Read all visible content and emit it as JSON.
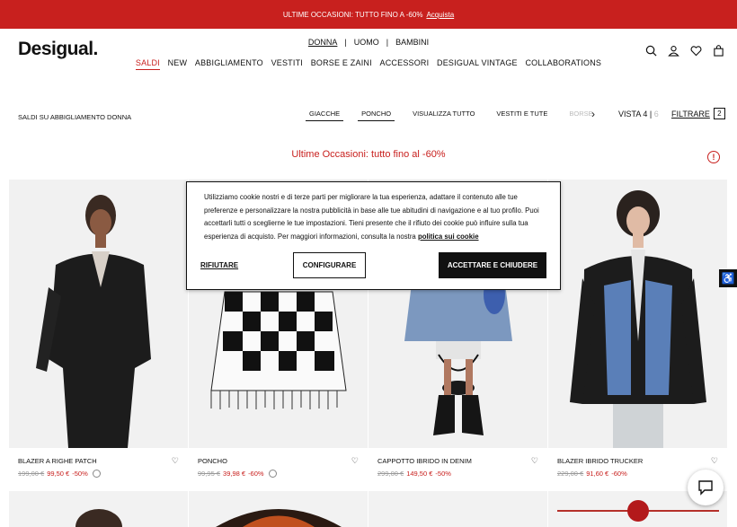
{
  "promo": {
    "text": "ULTIME OCCASIONI: TUTTO FINO A -60%",
    "link": "Acquista"
  },
  "header": {
    "logo": "Desigual.",
    "gender_nav": [
      "DONNA",
      "UOMO",
      "BAMBINI"
    ],
    "separator": "|",
    "main_nav": [
      "SALDI",
      "NEW",
      "ABBIGLIAMENTO",
      "VESTITI",
      "BORSE E ZAINI",
      "ACCESSORI",
      "DESIGUAL VINTAGE",
      "COLLABORATIONS"
    ],
    "icons": [
      "search-icon",
      "user-icon",
      "heart-icon",
      "bag-icon"
    ]
  },
  "subbar": {
    "breadcrumb": "SALDI SU ABBIGLIAMENTO DONNA",
    "chips": [
      "GIACCHE",
      "PONCHO",
      "VISUALIZZA TUTTO",
      "VESTITI E TUTE",
      "BORSE"
    ],
    "vista_label": "VISTA 4",
    "vista_sep": "|",
    "vista_alt": "6",
    "filter_label": "FILTRARE",
    "filter_count": "2"
  },
  "banner": "Ultime Occasioni: tutto fino al -60%",
  "products": [
    {
      "name": "BLAZER A RIGHE PATCH",
      "old_price": "199,00 €",
      "new_price": "99,50 €",
      "discount": "-50%"
    },
    {
      "name": "PONCHO",
      "old_price": "99,95 €",
      "new_price": "39,98 €",
      "discount": "-60%"
    },
    {
      "name": "CAPPOTTO IBRIDO IN DENIM",
      "old_price": "299,00 €",
      "new_price": "149,50 €",
      "discount": "-50%"
    },
    {
      "name": "BLAZER IBRIDO TRUCKER",
      "old_price": "229,00 €",
      "new_price": "91,60 €",
      "discount": "-60%"
    }
  ],
  "cookie": {
    "text": "Utilizziamo cookie nostri e di terze parti per migliorare la tua esperienza, adattare il contenuto alle tue preferenze e personalizzare la nostra pubblicità in base alle tue abitudini di navigazione e al tuo profilo. Puoi accettarli tutti o sceglierne le tue impostazioni. Tieni presente che il rifiuto dei cookie può influire sulla tua esperienza di acquisto. Per maggiori informazioni, consulta la nostra",
    "policy_link": "politica sui cookie",
    "reject": "RIFIUTARE",
    "configure": "CONFIGURARE",
    "accept": "ACCETTARE E CHIUDERE"
  },
  "colors": {
    "brand_red": "#c8201e",
    "black": "#111111"
  }
}
